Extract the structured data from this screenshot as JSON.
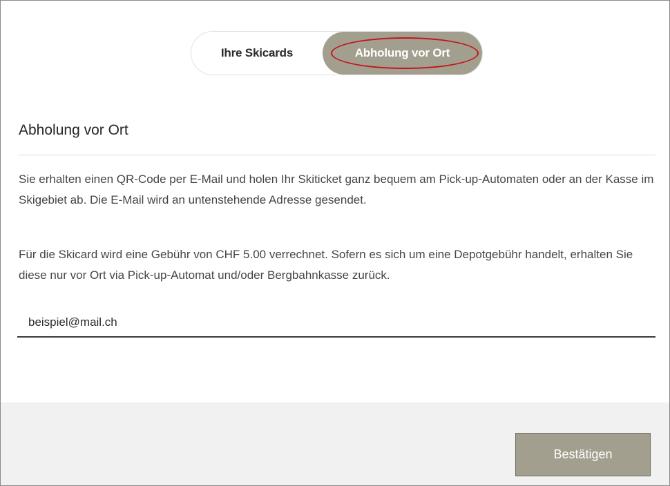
{
  "toggle": {
    "options": [
      {
        "label": "Ihre Skicards",
        "selected": false
      },
      {
        "label": "Abholung vor Ort",
        "selected": true
      }
    ]
  },
  "section": {
    "title": "Abholung vor Ort",
    "paragraph1": "Sie erhalten einen QR-Code per E-Mail und holen Ihr Skiticket ganz bequem am Pick-up-Automaten oder an der Kasse im Skigebiet ab. Die E-Mail wird an untenstehende Adresse gesendet.",
    "paragraph2": "Für die Skicard wird eine Gebühr von CHF 5.00 verrechnet. Sofern es sich um eine Depotgebühr handelt, erhalten Sie diese nur vor Ort via Pick-up-Automat und/oder Bergbahnkasse zurück."
  },
  "email": {
    "value": "beispiel@mail.ch"
  },
  "footer": {
    "confirm_label": "Bestätigen"
  },
  "colors": {
    "accent": "#a39f8f",
    "highlight": "#c3141b"
  }
}
